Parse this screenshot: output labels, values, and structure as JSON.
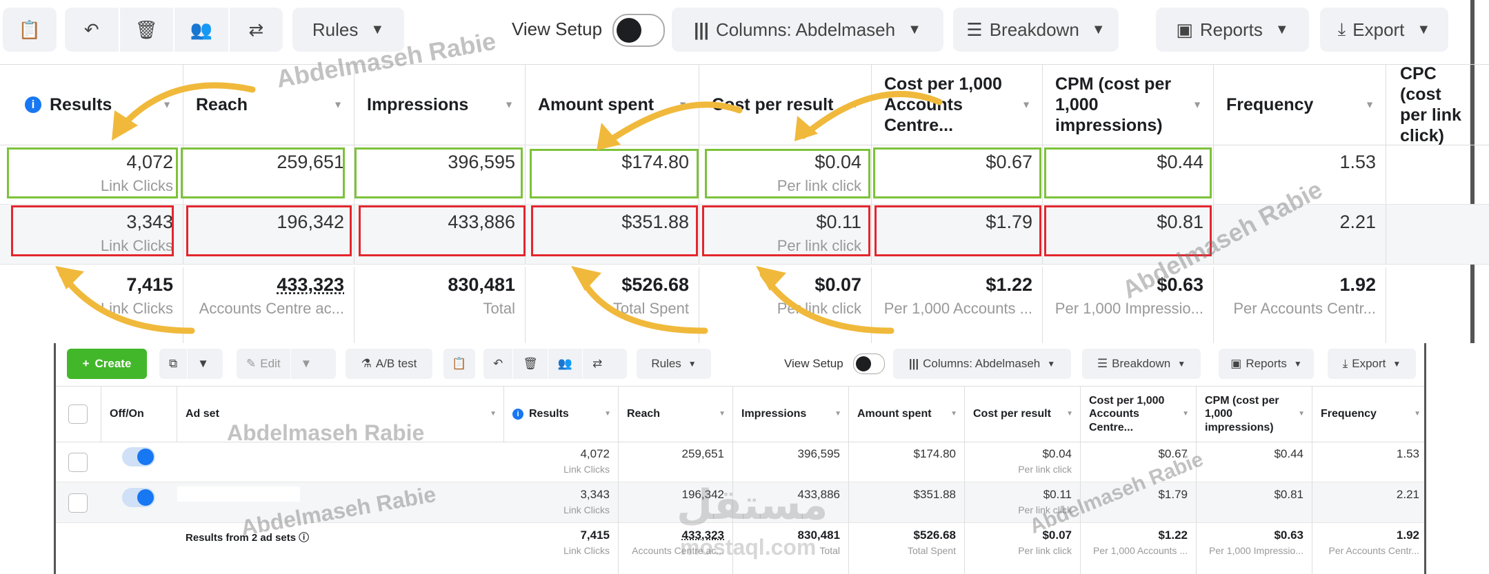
{
  "toolbar": {
    "rules": "Rules",
    "view_setup": "View Setup",
    "columns": "Columns: Abdelmaseh",
    "breakdown": "Breakdown",
    "reports": "Reports",
    "export": "Export",
    "create": "Create",
    "edit": "Edit",
    "ab_test": "A/B test"
  },
  "columns": {
    "off_on": "Off/On",
    "ad_set": "Ad set",
    "results": "Results",
    "reach": "Reach",
    "impressions": "Impressions",
    "amount_spent": "Amount spent",
    "cost_per_result": "Cost per result",
    "cost_per_1000": "Cost per 1,000 Accounts Centre...",
    "cpm": "CPM (cost per 1,000 impressions)",
    "frequency": "Frequency",
    "cpc": "CPC (cost per link click)"
  },
  "rows": [
    {
      "results": "4,072",
      "results_sub": "Link Clicks",
      "reach": "259,651",
      "impressions": "396,595",
      "amount_spent": "$174.80",
      "cost_per_result": "$0.04",
      "cost_per_result_sub": "Per link click",
      "cost_per_1000": "$0.67",
      "cpm": "$0.44",
      "frequency": "1.53"
    },
    {
      "results": "3,343",
      "results_sub": "Link Clicks",
      "reach": "196,342",
      "impressions": "433,886",
      "amount_spent": "$351.88",
      "cost_per_result": "$0.11",
      "cost_per_result_sub": "Per link click",
      "cost_per_1000": "$1.79",
      "cpm": "$0.81",
      "frequency": "2.21"
    }
  ],
  "totals": {
    "label": "Results from 2 ad sets",
    "results": "7,415",
    "results_sub": "Link Clicks",
    "reach": "433,323",
    "reach_sub": "Accounts Centre ac...",
    "impressions": "830,481",
    "impressions_sub": "Total",
    "amount_spent": "$526.68",
    "amount_spent_sub": "Total Spent",
    "cost_per_result": "$0.07",
    "cost_per_result_sub": "Per link click",
    "cost_per_1000": "$1.22",
    "cost_per_1000_sub": "Per 1,000 Accounts ...",
    "cpm": "$0.63",
    "cpm_sub": "Per 1,000 Impressio...",
    "frequency": "1.92",
    "frequency_sub": "Per Accounts Centr..."
  },
  "watermarks": {
    "name": "Abdelmaseh Rabie",
    "logo": "مستقل",
    "logo_latin": "mostaql.com"
  },
  "colors": {
    "good_box": "#7cc23a",
    "bad_box": "#e3262d",
    "arrow": "#f0b93b",
    "create_button": "#42b72a",
    "toggle_on": "#1877f2",
    "info_icon": "#1877f2"
  }
}
